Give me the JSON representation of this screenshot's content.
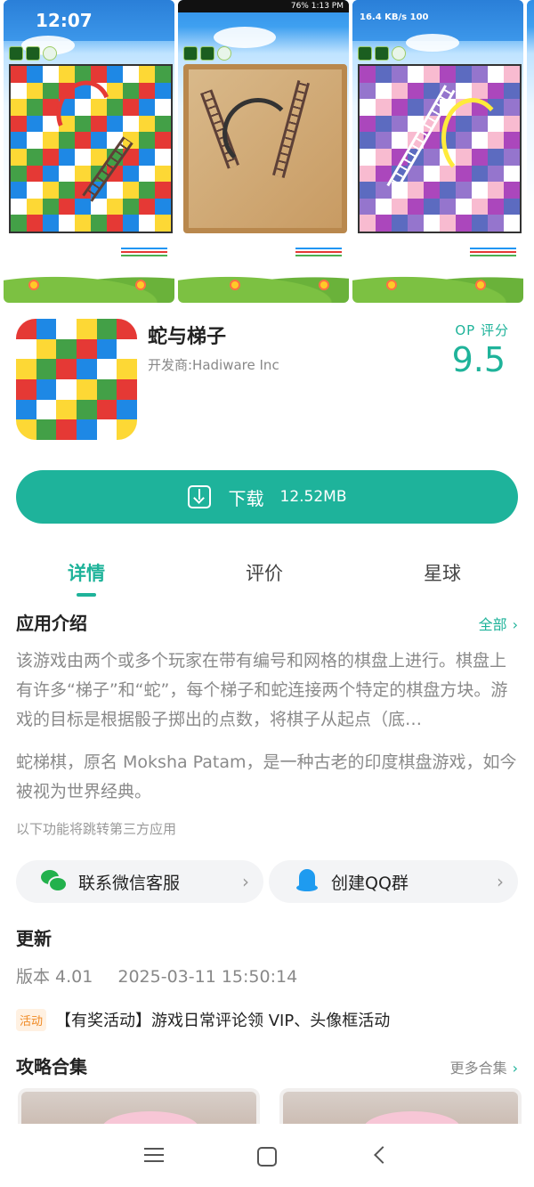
{
  "screenshots": [
    {
      "status_text": "12:07"
    },
    {
      "status_text": "76% 1:13 PM"
    },
    {
      "status_text": "16.4 KB/s  100"
    }
  ],
  "app": {
    "title": "蛇与梯子",
    "developer": "开发商:Hadiware Inc",
    "score_label": "OP 评分",
    "score": "9.5"
  },
  "download": {
    "label": "下载",
    "size": "12.52MB",
    "icon": "download-icon"
  },
  "tabs": [
    {
      "label": "详情",
      "active": true
    },
    {
      "label": "评价",
      "active": false
    },
    {
      "label": "星球",
      "active": false
    }
  ],
  "intro": {
    "title": "应用介绍",
    "more": "全部",
    "paragraph1": "该游戏由两个或多个玩家在带有编号和网格的棋盘上进行。棋盘上有许多“梯子”和“蛇”，每个梯子和蛇连接两个特定的棋盘方块。游戏的目标是根据骰子掷出的点数，将棋子从起点（底…",
    "paragraph2": "蛇梯棋，原名 Moksha Patam，是一种古老的印度棋盘游戏，如今被视为世界经典。",
    "third_party_note": "以下功能将跳转第三方应用"
  },
  "services": [
    {
      "label": "联系微信客服",
      "icon": "wechat-icon"
    },
    {
      "label": "创建QQ群",
      "icon": "qq-icon"
    }
  ],
  "update": {
    "title": "更新",
    "version": "版本 4.01",
    "date": "2025-03-11 15:50:14"
  },
  "event": {
    "badge": "活动",
    "text": "【有奖活动】游戏日常评论领 VIP、头像框活动"
  },
  "guides": {
    "title": "攻略合集",
    "more": "更多合集"
  },
  "nav": {
    "menu": "menu-icon",
    "home": "home-icon",
    "back": "back-icon"
  },
  "colors": {
    "accent": "#1fb39a",
    "download_button": "#1eb39b"
  }
}
